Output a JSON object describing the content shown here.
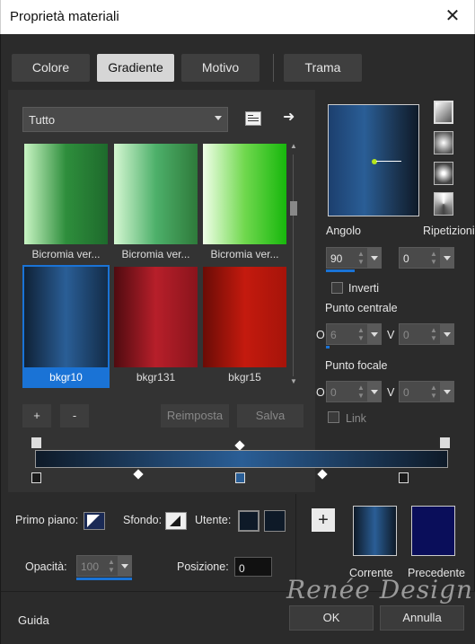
{
  "window": {
    "title": "Proprietà materiali"
  },
  "tabs": [
    {
      "label": "Colore",
      "active": false
    },
    {
      "label": "Gradiente",
      "active": true
    },
    {
      "label": "Motivo",
      "active": false
    },
    {
      "label": "Trama",
      "active": false
    }
  ],
  "category_select": {
    "value": "Tutto"
  },
  "gradients": [
    {
      "label": "Bicromia ver...",
      "colors": [
        "#c9f5c4",
        "#2e8e3c",
        "#1e6a2c"
      ],
      "selected": false
    },
    {
      "label": "Bicromia ver...",
      "colors": [
        "#d5f7d2",
        "#4db06a",
        "#2e7a3a"
      ],
      "selected": false
    },
    {
      "label": "Bicromia ver...",
      "colors": [
        "#f0ffe8",
        "#70d84e",
        "#17b70c"
      ],
      "selected": false
    },
    {
      "label": "bkgr10",
      "colors": [
        "#0f2136",
        "#2a5e96",
        "#132c48"
      ],
      "selected": true
    },
    {
      "label": "bkgr131",
      "colors": [
        "#4f0b10",
        "#b71f2a",
        "#8a141c"
      ],
      "selected": false
    },
    {
      "label": "bkgr15",
      "colors": [
        "#6a0c06",
        "#c41a0e",
        "#a6140a"
      ],
      "selected": false
    }
  ],
  "buttons": {
    "add": "+",
    "remove": "-",
    "reset": "Reimposta",
    "save": "Salva",
    "ok": "OK",
    "cancel": "Annulla",
    "help": "Guida"
  },
  "angle": {
    "label": "Angolo",
    "value": "90"
  },
  "repeats": {
    "label": "Ripetizioni",
    "value": "0"
  },
  "invert": {
    "label": "Inverti",
    "checked": false
  },
  "center_point": {
    "label": "Punto centrale",
    "h_label": "O",
    "h_value": "6",
    "v_label": "V",
    "v_value": "0"
  },
  "focal_point": {
    "label": "Punto focale",
    "h_label": "O",
    "h_value": "0",
    "v_label": "V",
    "v_value": "0"
  },
  "link": {
    "label": "Link",
    "checked": false
  },
  "foreground": {
    "label": "Primo piano:"
  },
  "background": {
    "label": "Sfondo:"
  },
  "user": {
    "label": "Utente:"
  },
  "opacity": {
    "label": "Opacità:",
    "value": "100"
  },
  "position": {
    "label": "Posizione:",
    "value": "0"
  },
  "current": {
    "label": "Corrente"
  },
  "previous": {
    "label": "Precedente"
  },
  "watermark": "Renée Design",
  "colors": {
    "accent": "#1a73d6",
    "gradient_start": "#0e1a28",
    "gradient_mid": "#2a5e96",
    "gradient_end": "#0e1a28",
    "previous_color": "#0a0e5a"
  }
}
